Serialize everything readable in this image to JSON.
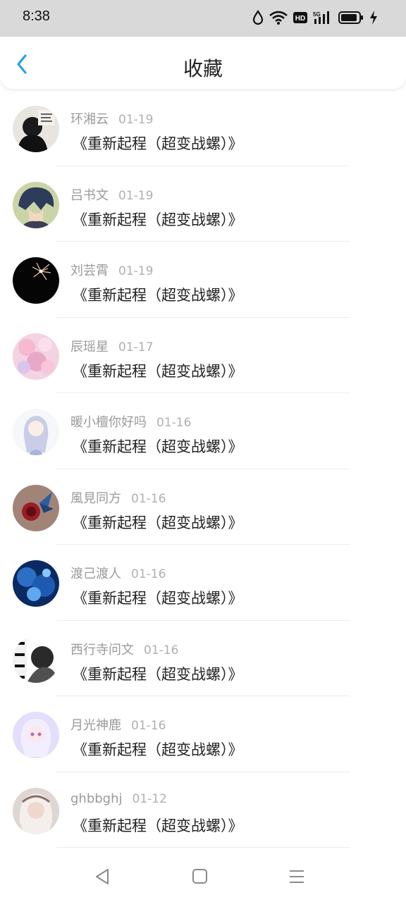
{
  "status_bar": {
    "time": "8:38",
    "icons": [
      "drop-icon",
      "wifi-icon",
      "hd-icon",
      "signal-5g-icon",
      "battery-icon",
      "charging-icon"
    ]
  },
  "header": {
    "title": "收藏",
    "back_icon": "chevron-left-icon",
    "accent_color": "#2aa0e8"
  },
  "items": [
    {
      "name": "环湘云",
      "date": "01-19",
      "title": "《重新起程（超变战螺）》"
    },
    {
      "name": "吕书文",
      "date": "01-19",
      "title": "《重新起程（超变战螺）》"
    },
    {
      "name": "刘芸霄",
      "date": "01-19",
      "title": "《重新起程（超变战螺）》"
    },
    {
      "name": "辰瑶星",
      "date": "01-17",
      "title": "《重新起程（超变战螺）》"
    },
    {
      "name": "暖小檀你好吗",
      "date": "01-16",
      "title": "《重新起程（超变战螺）》"
    },
    {
      "name": "風見同方",
      "date": "01-16",
      "title": "《重新起程（超变战螺）》"
    },
    {
      "name": "渡己渡人",
      "date": "01-16",
      "title": "《重新起程（超变战螺）》"
    },
    {
      "name": "西行寺问文",
      "date": "01-16",
      "title": "《重新起程（超变战螺）》"
    },
    {
      "name": "月光神鹿",
      "date": "01-16",
      "title": "《重新起程（超变战螺）》"
    },
    {
      "name": "ghbbghj",
      "date": "01-12",
      "title": "《重新起程（超变战螺）》"
    }
  ],
  "nav_bar": {
    "icons": [
      "back-triangle-icon",
      "home-square-icon",
      "menu-lines-icon"
    ]
  }
}
